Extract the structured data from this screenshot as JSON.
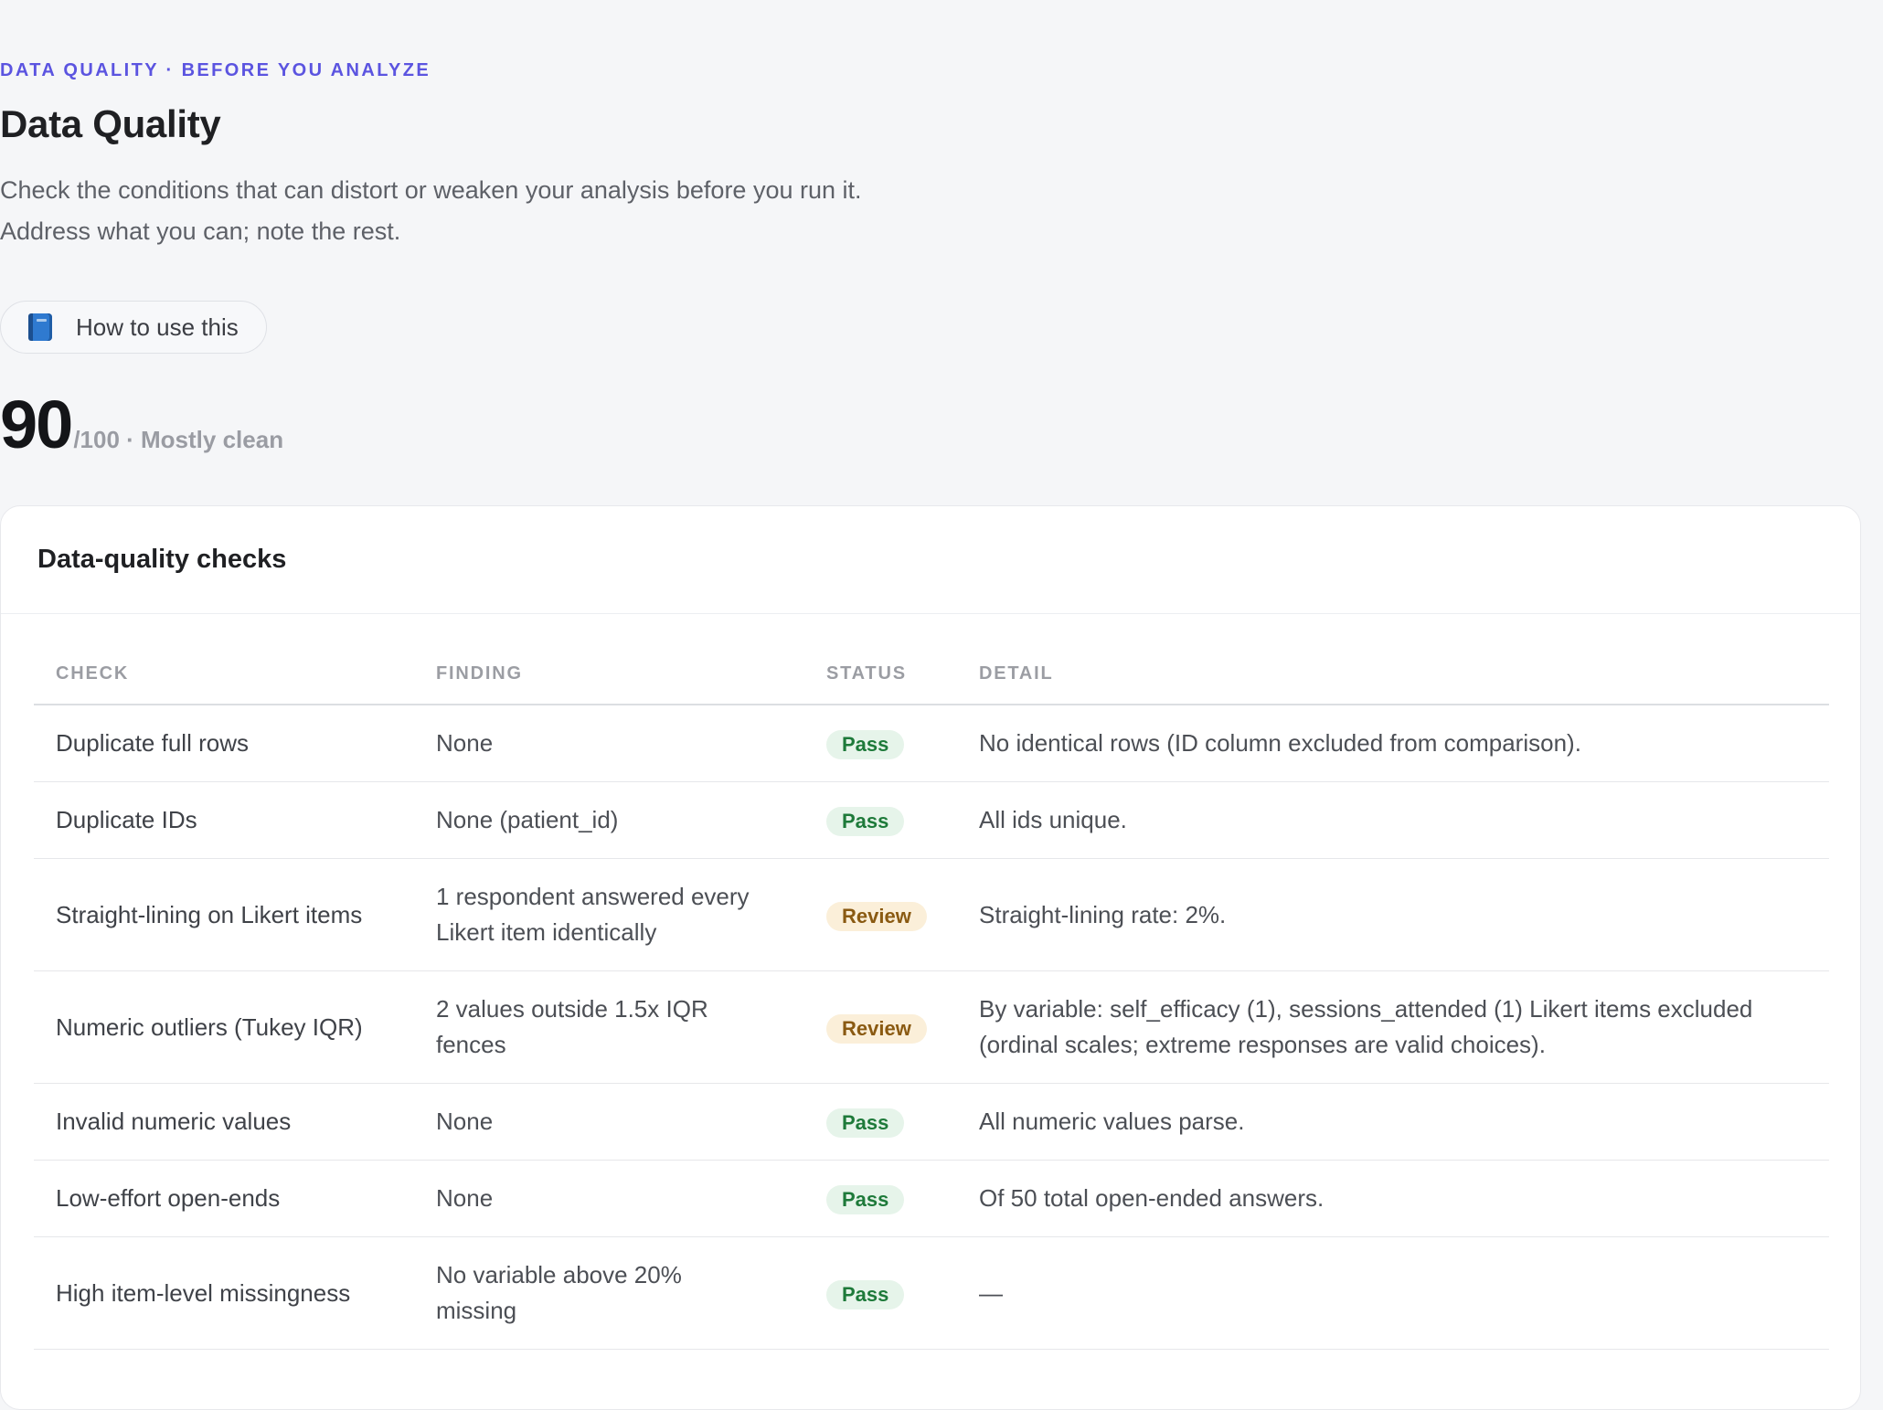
{
  "header": {
    "eyebrow": "DATA QUALITY · BEFORE YOU ANALYZE",
    "title": "Data Quality",
    "subtitle_lines": [
      "Check the conditions that can distort or weaken your analysis before you run it.",
      "Address what you can; note the rest."
    ],
    "howto_label": "How to use this",
    "howto_icon": "book-icon"
  },
  "score": {
    "value": "90",
    "suffix": "/100 · Mostly clean"
  },
  "card": {
    "title": "Data-quality checks",
    "columns": [
      "CHECK",
      "FINDING",
      "STATUS",
      "DETAIL"
    ],
    "rows": [
      {
        "check": "Duplicate full rows",
        "finding_lines": [
          "None"
        ],
        "status": "Pass",
        "detail_lines": [
          "No identical rows (ID column excluded from comparison)."
        ]
      },
      {
        "check": "Duplicate IDs",
        "finding_lines": [
          "None (patient_id)"
        ],
        "status": "Pass",
        "detail_lines": [
          "All ids unique."
        ]
      },
      {
        "check": "Straight-lining on Likert items",
        "finding_lines": [
          "1 respondent answered every",
          "Likert item identically"
        ],
        "status": "Review",
        "detail_lines": [
          "Straight-lining rate: 2%."
        ]
      },
      {
        "check": "Numeric outliers (Tukey IQR)",
        "finding_lines": [
          "2 values outside 1.5x IQR",
          "fences"
        ],
        "status": "Review",
        "detail_lines": [
          "By variable: self_efficacy (1), sessions_attended (1) Likert items excluded",
          "(ordinal scales; extreme responses are valid choices)."
        ]
      },
      {
        "check": "Invalid numeric values",
        "finding_lines": [
          "None"
        ],
        "status": "Pass",
        "detail_lines": [
          "All numeric values parse."
        ]
      },
      {
        "check": "Low-effort open-ends",
        "finding_lines": [
          "None"
        ],
        "status": "Pass",
        "detail_lines": [
          "Of 50 total open-ended answers."
        ]
      },
      {
        "check": "High item-level missingness",
        "finding_lines": [
          "No variable above 20%",
          "missing"
        ],
        "status": "Pass",
        "detail_lines": [
          "—"
        ]
      }
    ]
  },
  "colors": {
    "accent": "#5b54e0",
    "pass_bg": "#e6f4ea",
    "pass_text": "#1e7a3a",
    "review_bg": "#fbefd9",
    "review_text": "#8a5a12",
    "page_bg": "#f5f6f8"
  }
}
